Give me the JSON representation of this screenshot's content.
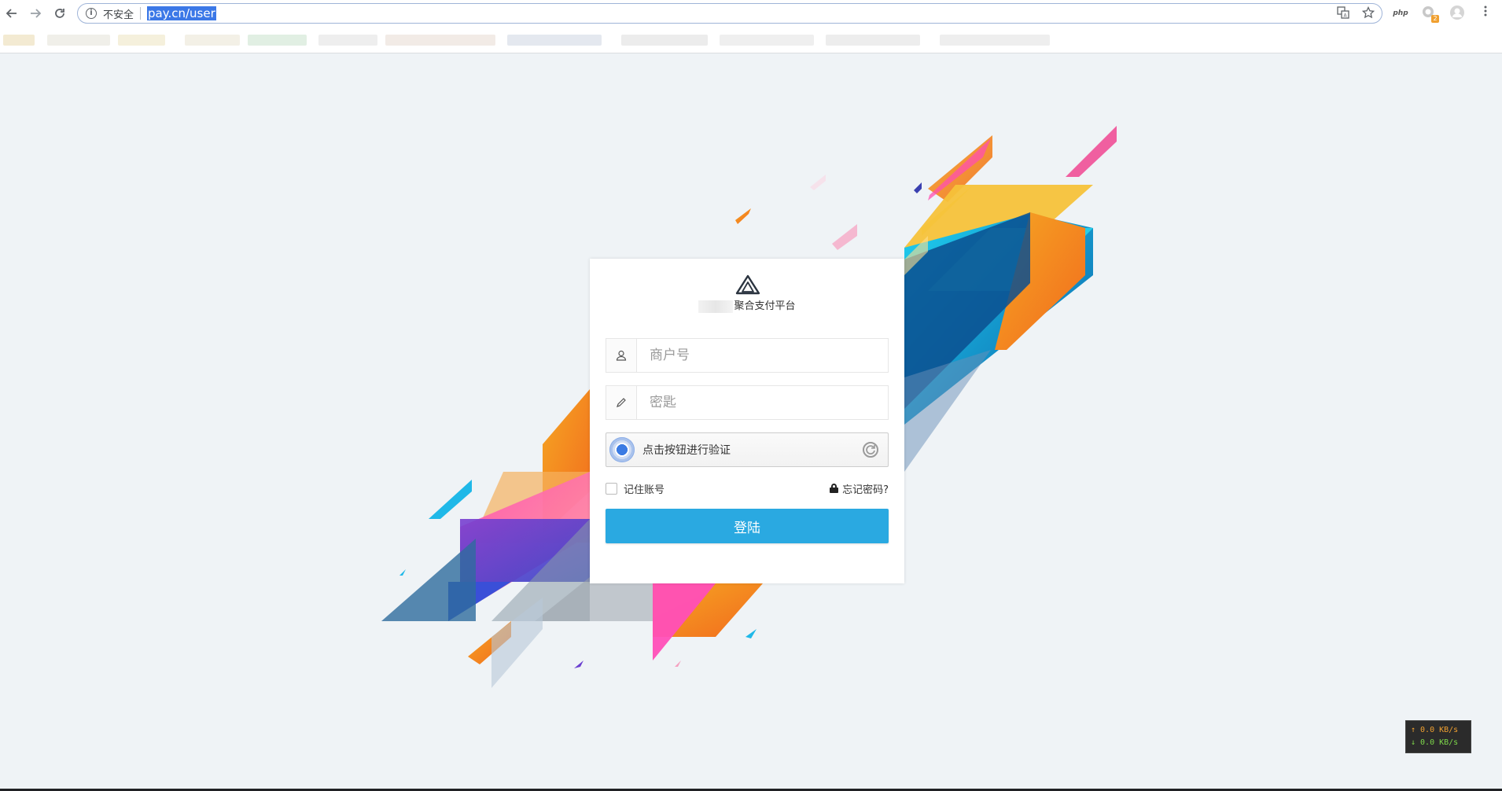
{
  "browser": {
    "security_label": "不安全",
    "url": "pay.cn/user",
    "ext_php_label": "php",
    "ext_badge_count": "2"
  },
  "login": {
    "brand_name": "聚合支付平台",
    "merchant_placeholder": "商户号",
    "password_placeholder": "密匙",
    "verify_text": "点击按钮进行验证",
    "remember_label": "记住账号",
    "forgot_label": "忘记密码?",
    "submit_label": "登陆"
  },
  "netspeed": {
    "upload": "↑ 0.0 KB/s",
    "download": "↓ 0.0 KB/s"
  },
  "colors": {
    "primary_button": "#2aa9e1",
    "page_background": "#eff3f6",
    "url_highlight": "#3b78e7"
  }
}
